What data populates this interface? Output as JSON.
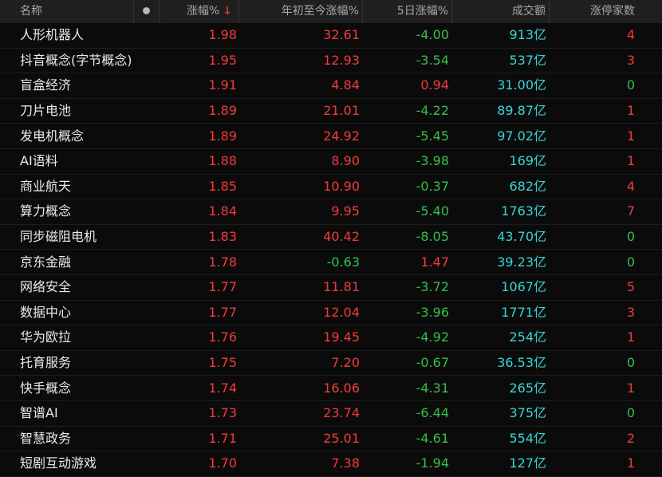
{
  "header": {
    "name": "名称",
    "change": "涨幅%",
    "ytd": "年初至今涨幅%",
    "five_day": "5日涨幅%",
    "volume": "成交额",
    "limit_up": "涨停家数"
  },
  "colors": {
    "up": "#f23b3b",
    "down": "#35c24a",
    "volume": "#3ad4d4",
    "background": "#0b0b0b",
    "header_bg": "#1f1f1f"
  },
  "rows": [
    {
      "name": "人形机器人",
      "change": "1.98",
      "ytd": "32.61",
      "five_day": "-4.00",
      "volume": "913亿",
      "limit_up": "4"
    },
    {
      "name": "抖音概念(字节概念)",
      "change": "1.95",
      "ytd": "12.93",
      "five_day": "-3.54",
      "volume": "537亿",
      "limit_up": "3"
    },
    {
      "name": "盲盒经济",
      "change": "1.91",
      "ytd": "4.84",
      "five_day": "0.94",
      "volume": "31.00亿",
      "limit_up": "0"
    },
    {
      "name": "刀片电池",
      "change": "1.89",
      "ytd": "21.01",
      "five_day": "-4.22",
      "volume": "89.87亿",
      "limit_up": "1"
    },
    {
      "name": "发电机概念",
      "change": "1.89",
      "ytd": "24.92",
      "five_day": "-5.45",
      "volume": "97.02亿",
      "limit_up": "1"
    },
    {
      "name": "AI语料",
      "change": "1.88",
      "ytd": "8.90",
      "five_day": "-3.98",
      "volume": "169亿",
      "limit_up": "1"
    },
    {
      "name": "商业航天",
      "change": "1.85",
      "ytd": "10.90",
      "five_day": "-0.37",
      "volume": "682亿",
      "limit_up": "4"
    },
    {
      "name": "算力概念",
      "change": "1.84",
      "ytd": "9.95",
      "five_day": "-5.40",
      "volume": "1763亿",
      "limit_up": "7"
    },
    {
      "name": "同步磁阻电机",
      "change": "1.83",
      "ytd": "40.42",
      "five_day": "-8.05",
      "volume": "43.70亿",
      "limit_up": "0"
    },
    {
      "name": "京东金融",
      "change": "1.78",
      "ytd": "-0.63",
      "five_day": "1.47",
      "volume": "39.23亿",
      "limit_up": "0"
    },
    {
      "name": "网络安全",
      "change": "1.77",
      "ytd": "11.81",
      "five_day": "-3.72",
      "volume": "1067亿",
      "limit_up": "5"
    },
    {
      "name": "数据中心",
      "change": "1.77",
      "ytd": "12.04",
      "five_day": "-3.96",
      "volume": "1771亿",
      "limit_up": "3"
    },
    {
      "name": "华为欧拉",
      "change": "1.76",
      "ytd": "19.45",
      "five_day": "-4.92",
      "volume": "254亿",
      "limit_up": "1"
    },
    {
      "name": "托育服务",
      "change": "1.75",
      "ytd": "7.20",
      "five_day": "-0.67",
      "volume": "36.53亿",
      "limit_up": "0"
    },
    {
      "name": "快手概念",
      "change": "1.74",
      "ytd": "16.06",
      "five_day": "-4.31",
      "volume": "265亿",
      "limit_up": "1"
    },
    {
      "name": "智谱AI",
      "change": "1.73",
      "ytd": "23.74",
      "five_day": "-6.44",
      "volume": "375亿",
      "limit_up": "0"
    },
    {
      "name": "智慧政务",
      "change": "1.71",
      "ytd": "25.01",
      "five_day": "-4.61",
      "volume": "554亿",
      "limit_up": "2"
    },
    {
      "name": "短剧互动游戏",
      "change": "1.70",
      "ytd": "7.38",
      "five_day": "-1.94",
      "volume": "127亿",
      "limit_up": "1"
    }
  ]
}
